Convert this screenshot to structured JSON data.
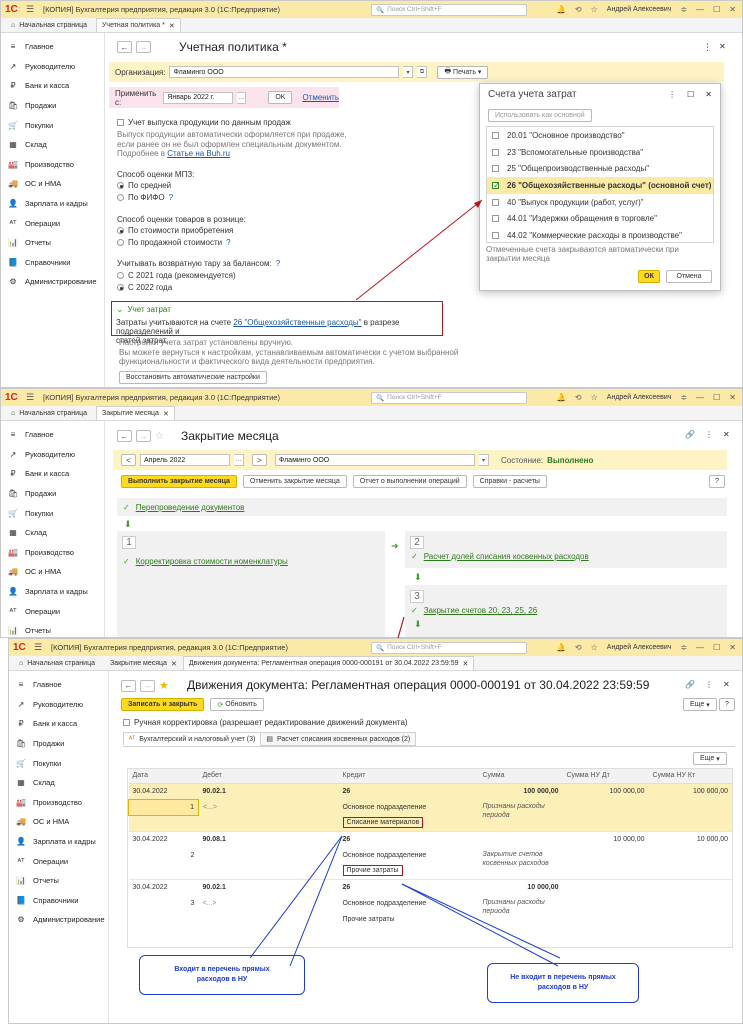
{
  "app": {
    "logo": "1С",
    "title": "[КОПИЯ] Бухгалтерия предприятия, редакция 3.0  (1С:Предприятие)",
    "search_placeholder": "Поиск Ctrl+Shift+F",
    "user": "Андрей Алексеевич"
  },
  "sidebar": {
    "items": [
      {
        "icon": "≡",
        "label": "Главное"
      },
      {
        "icon": "↗",
        "label": "Руководителю"
      },
      {
        "icon": "₽",
        "label": "Банк и касса"
      },
      {
        "icon": "🛍",
        "label": "Продажи"
      },
      {
        "icon": "🛒",
        "label": "Покупки"
      },
      {
        "icon": "▦",
        "label": "Склад"
      },
      {
        "icon": "🏭",
        "label": "Производство"
      },
      {
        "icon": "🚚",
        "label": "ОС и НМА"
      },
      {
        "icon": "👤",
        "label": "Зарплата и кадры"
      },
      {
        "icon": "ᴬᵀ",
        "label": "Операции"
      },
      {
        "icon": "📊",
        "label": "Отчеты"
      },
      {
        "icon": "📘",
        "label": "Справочники"
      },
      {
        "icon": "⚙",
        "label": "Администрирование"
      }
    ]
  },
  "w1": {
    "tabs": {
      "home": "Начальная страница",
      "active": "Учетная политика *"
    },
    "title": "Учетная политика *",
    "org_label": "Организация:",
    "org_value": "Фламинго ООО",
    "print_label": "Печать",
    "apply_label": "Применить с:",
    "apply_value": "Январь 2022 г.",
    "ok_label": "OK",
    "cancel_link": "Отменить",
    "production_checkbox": "Учет выпуска продукции по данным продаж",
    "production_hint1": "Выпуск продукции автоматически оформляется при продаже,",
    "production_hint2": "если ранее он не был оформлен специальным документом.",
    "production_hint3_prefix": "Подробнее в ",
    "production_hint3_link": "Статье на Buh.ru",
    "mpz_label": "Способ оценки МПЗ:",
    "mpz_opt1": "По средней",
    "mpz_opt2": "По ФИФО",
    "retail_label": "Способ оценки товаров в рознице:",
    "retail_opt1": "По стоимости приобретения",
    "retail_opt2": "По продажной стоимости",
    "tara_label": "Учитывать возвратную тару за балансом:",
    "tara_opt1": "С 2021 года (рекомендуется)",
    "tara_opt2": "С 2022 года",
    "costs_header": "Учет затрат",
    "costs_text_prefix": "Затраты учитываются на счете ",
    "costs_text_link": "26 \"Общехозяйственные расходы\"",
    "costs_text_suffix": " в разрезе подразделений и",
    "costs_text_line2": "статей затрат.",
    "manual_hint1": "Настройки учета затрат установлены вручную.",
    "manual_hint2": "Вы можете вернуться к настройкам, устанавливаемым автоматически с учетом выбранной",
    "manual_hint3": "функциональности и фактического вида деятельности предприятия.",
    "restore_button": "Восстановить автоматические настройки"
  },
  "dialog": {
    "title": "Счета учета затрат",
    "use_main_button": "Использовать как основной",
    "items": [
      {
        "label": "20.01 \"Основное производство\"",
        "checked": false
      },
      {
        "label": "23 \"Вспомогательные производства\"",
        "checked": false
      },
      {
        "label": "25 \"Общепроизводственные расходы\"",
        "checked": false
      },
      {
        "label": "26 \"Общехозяйственные расходы\" (основной счет)",
        "checked": true
      },
      {
        "label": "40 \"Выпуск продукции (работ, услуг)\"",
        "checked": false
      },
      {
        "label": "44.01 \"Издержки обращения в торговле\"",
        "checked": false
      },
      {
        "label": "44.02 \"Коммерческие расходы в производстве\"",
        "checked": false
      }
    ],
    "hint": "Отмеченные счета закрываются автоматически при закрытии месяца",
    "ok": "ОК",
    "cancel": "Отмена"
  },
  "w2": {
    "tabs": {
      "home": "Начальная страница",
      "active": "Закрытие месяца"
    },
    "title": "Закрытие месяца",
    "period": "Апрель 2022",
    "org": "Фламинго ООО",
    "state_label": "Состояние:",
    "state_value": "Выполнено",
    "buttons": {
      "run": "Выполнить закрытие месяца",
      "undo": "Отменить закрытие месяца",
      "report": "Отчет о выполнении операций",
      "refs": "Справки - расчеты",
      "help": "?"
    },
    "step0": "Перепроведение документов",
    "step1_num": "1",
    "step1": "Корректировка стоимости номенклатуры",
    "step2_num": "2",
    "step2": "Расчет долей списания косвенных расходов",
    "step3_num": "3",
    "step3": "Закрытие счетов 20, 23, 25, 26"
  },
  "w3": {
    "tabs": {
      "home": "Начальная страница",
      "t1": "Закрытие месяца",
      "active": "Движения документа: Регламентная операция 0000-000191 от 30.04.2022 23:59:59"
    },
    "title": "Движения документа: Регламентная операция 0000-000191 от 30.04.2022 23:59:59",
    "save_close": "Записать и закрыть",
    "refresh": "Обновить",
    "more": "Еще",
    "help": "?",
    "manual_checkbox": "Ручная корректировка (разрешает редактирование движений документа)",
    "subtab1": "Бухгалтерский и налоговый учет (3)",
    "subtab2": "Расчет списания косвенных расходов (2)",
    "more2": "Еще",
    "columns": [
      "Дата",
      "Дебет",
      "Кредит",
      "Сумма",
      "Сумма НУ Дт",
      "Сумма НУ Кт"
    ],
    "rows": [
      {
        "date": "30.04.2022",
        "n": "1",
        "debit": "90.02.1",
        "debit_sub": "<...>",
        "credit": "26",
        "credit_sub1": "Основное подразделение",
        "credit_sub2": "Списание материалов",
        "sum": "100 000,00",
        "sum_note": "Признаны расходы периода",
        "nu_dt": "100 000,00",
        "nu_kt": "100 000,00"
      },
      {
        "date": "30.04.2022",
        "n": "2",
        "debit": "90.08.1",
        "debit_sub": "",
        "credit": "26",
        "credit_sub1": "Основное подразделение",
        "credit_sub2": "Прочие затраты",
        "sum": "",
        "sum_note": "Закрытие счетов косвенных расходов",
        "nu_dt": "10 000,00",
        "nu_kt": "10 000,00"
      },
      {
        "date": "30.04.2022",
        "n": "3",
        "debit": "90.02.1",
        "debit_sub": "<...>",
        "credit": "26",
        "credit_sub1": "Основное подразделение",
        "credit_sub2": "Прочие затраты",
        "sum": "10 000,00",
        "sum_note": "Признаны расходы периода",
        "nu_dt": "",
        "nu_kt": ""
      }
    ],
    "callout_left": "Входит в перечень прямых расходов в НУ",
    "callout_right": "Не входит в перечень прямых расходов в НУ"
  }
}
